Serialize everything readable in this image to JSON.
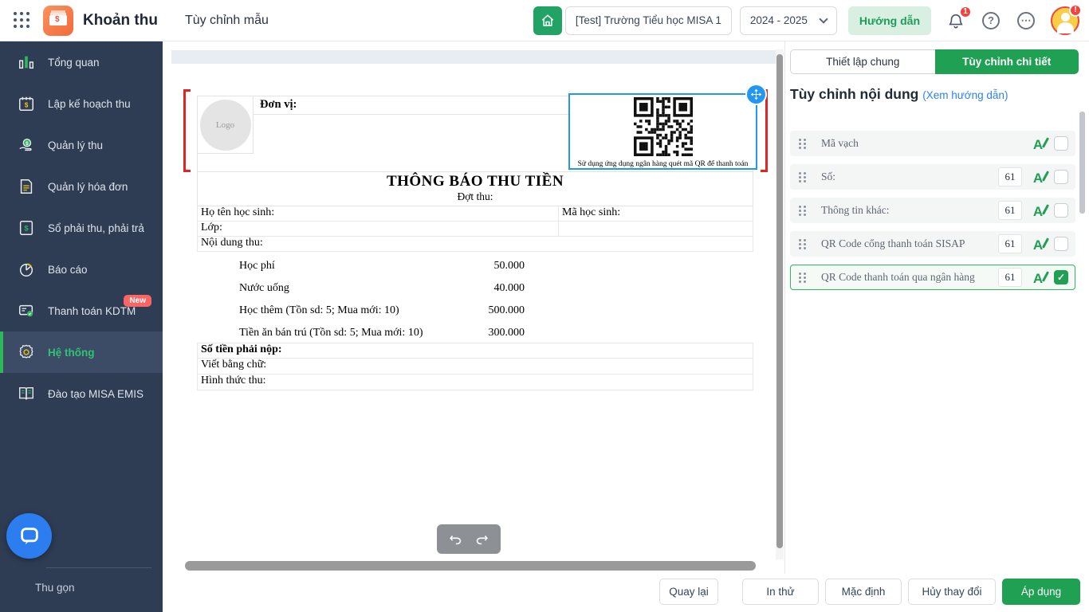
{
  "header": {
    "app_name": "Khoản thu",
    "page_title": "Tùy chỉnh mẫu",
    "school_name": "[Test] Trường Tiểu học MISA 1",
    "school_year": "2024 - 2025",
    "guide_label": "Hướng dẫn",
    "bell_badge": "1",
    "avatar_badge": "!",
    "question_glyph": "?",
    "ellipsis_glyph": "⋯"
  },
  "sidebar": {
    "items": [
      {
        "label": "Tổng quan"
      },
      {
        "label": "Lập kế hoạch thu"
      },
      {
        "label": "Quản lý thu"
      },
      {
        "label": "Quản lý hóa đơn"
      },
      {
        "label": "Sổ phải thu, phải trả"
      },
      {
        "label": "Báo cáo"
      },
      {
        "label": "Thanh toán KDTM",
        "badge": "New"
      },
      {
        "label": "Hệ thống",
        "active": true
      },
      {
        "label": "Đào tạo MISA EMIS"
      }
    ],
    "collapse_label": "Thu gọn"
  },
  "document": {
    "unit_label": "Đơn vị:",
    "logo_placeholder": "Logo",
    "qr_caption": "Sử dụng ứng dụng ngân hàng quét mã QR để thanh toán",
    "title": "THÔNG BÁO THU TIỀN",
    "period_label": "Đợt thu:",
    "student_name_label": "Họ tên học sinh:",
    "student_code_label": "Mã học sinh:",
    "class_label": "Lớp:",
    "content_label": "Nội dung thu:",
    "fees": [
      {
        "name": "Học phí",
        "amount": "50.000"
      },
      {
        "name": "Nước uống",
        "amount": "40.000"
      },
      {
        "name": "Học thêm (Tồn sd: 5; Mua mới: 10)",
        "amount": "500.000"
      },
      {
        "name": "Tiền ăn bán trú (Tồn sd: 5; Mua mới: 10)",
        "amount": "300.000"
      }
    ],
    "total_label": "Số tiền phải nộp:",
    "in_words_label": "Viết bằng chữ:",
    "method_label": "Hình thức thu:"
  },
  "panel": {
    "tabs": [
      {
        "label": "Thiết lập chung",
        "active": false
      },
      {
        "label": "Tùy chỉnh chi tiết",
        "active": true
      }
    ],
    "heading": "Tùy chỉnh nội dung",
    "heading_link": "(Xem hướng dẫn)",
    "items": [
      {
        "label": "Mã vạch",
        "size": "",
        "checked": false,
        "selected": false
      },
      {
        "label": "Số:",
        "size": "61",
        "checked": false,
        "selected": false
      },
      {
        "label": "Thông tin khác:",
        "size": "61",
        "checked": false,
        "selected": false
      },
      {
        "label": "QR Code cổng thanh toán SISAP",
        "size": "61",
        "checked": false,
        "selected": false
      },
      {
        "label": "QR Code thanh toán qua ngân hàng",
        "size": "61",
        "checked": true,
        "selected": true
      }
    ],
    "check_glyph": "✓"
  },
  "footer": {
    "buttons": [
      "Quay lại",
      "In thử",
      "Mặc định",
      "Hủy thay đổi",
      "Áp dụng"
    ]
  },
  "colors": {
    "brand_green": "#1fa053",
    "sidebar_bg": "#2e3d54",
    "active_green": "#2eb85c",
    "selection_blue": "#2196f3",
    "crop_mark_red": "#e02424",
    "link_blue": "#2f80ed",
    "badge_red": "#f4433c"
  }
}
